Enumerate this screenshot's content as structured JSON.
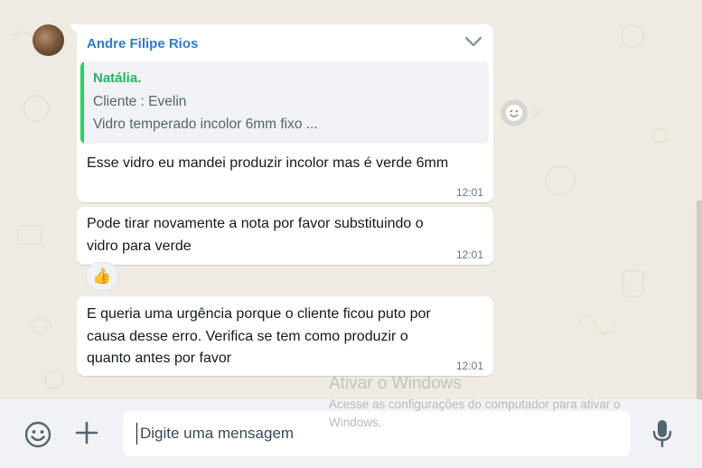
{
  "thread": {
    "message1": {
      "sender": "Andre Filipe Rios",
      "quote": {
        "author": "Natália.",
        "line1": "Cliente : Evelin",
        "line2": "Vidro temperado incolor 6mm fixo ..."
      },
      "text": "Esse vidro eu mandei produzir incolor mas é verde 6mm",
      "time": "12:01"
    },
    "message2": {
      "text_line1": "Pode tirar novamente a nota por favor substituindo o",
      "text_line2": "vidro para verde",
      "time": "12:01",
      "reaction": "👍"
    },
    "message3": {
      "text_line1": "E queria uma urgência porque o cliente ficou puto por",
      "text_line2": "causa desse erro. Verifica se tem como produzir o",
      "text_line3": "quanto antes por favor",
      "time": "12:01"
    }
  },
  "composer": {
    "placeholder": "Digite uma mensagem"
  },
  "watermark": {
    "title": "Ativar o Windows",
    "subtitle": "Acesse as configurações do computador para ativar o Windows."
  },
  "icons": {
    "emoji": "emoji-icon",
    "plus": "plus-icon",
    "mic": "microphone-icon",
    "chevron": "chevron-down-icon",
    "react": "smiley-icon"
  },
  "colors": {
    "chat_background": "#efeae2",
    "bubble": "#ffffff",
    "sender_name": "#2e7bcf",
    "quote_accent": "#25d366",
    "footer": "#f0f2f5"
  }
}
